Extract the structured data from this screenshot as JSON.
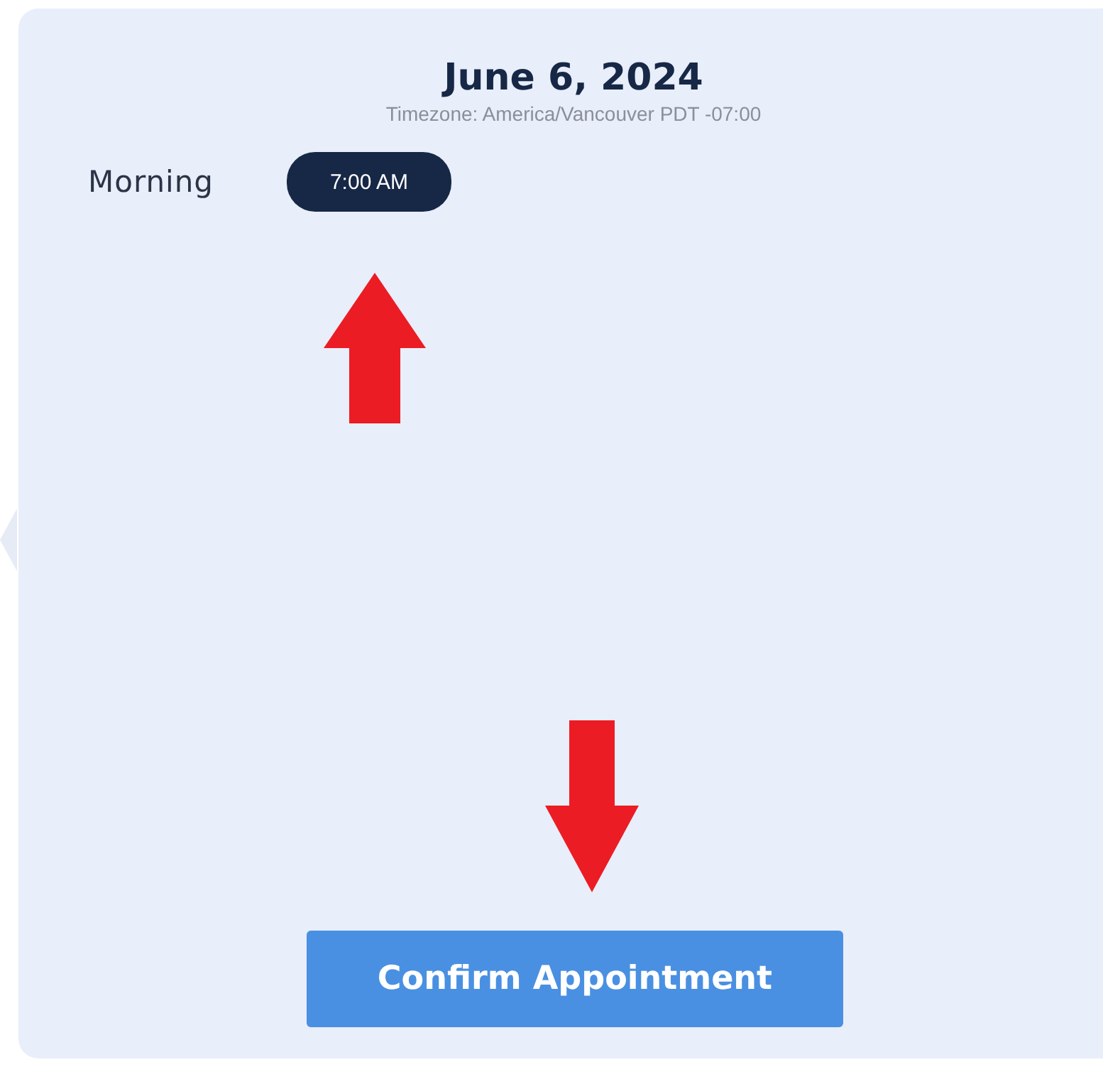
{
  "date_title": "June 6, 2024",
  "timezone": "Timezone: America/Vancouver PDT -07:00",
  "periods": [
    {
      "label": "Morning",
      "slots": [
        {
          "time": "7:00 AM",
          "selected": true
        }
      ]
    }
  ],
  "confirm_button": "Confirm Appointment"
}
